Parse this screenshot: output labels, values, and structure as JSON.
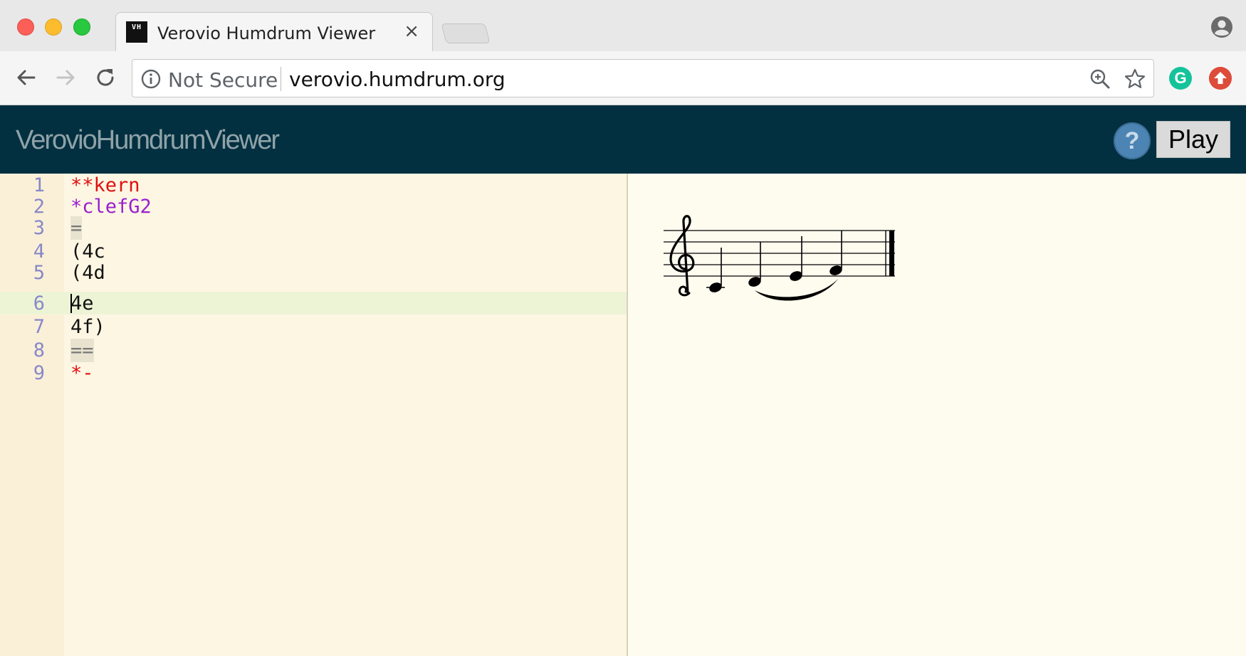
{
  "browser": {
    "tab_title": "Verovio Humdrum Viewer",
    "tab_close": "×",
    "favicon_text": "VH",
    "security_label": "Not Secure",
    "url": "verovio.humdrum.org"
  },
  "app": {
    "title": "VerovioHumdrumViewer",
    "help_label": "?",
    "play_label": "Play"
  },
  "editor": {
    "active_line": 6,
    "lines": [
      {
        "num": "1",
        "text": "**kern"
      },
      {
        "num": "2",
        "text": "*clefG2"
      },
      {
        "num": "3",
        "text": "="
      },
      {
        "num": "4",
        "text": "(4c"
      },
      {
        "num": "5",
        "text": "(4d"
      },
      {
        "num": "6",
        "text": "4e"
      },
      {
        "num": "7",
        "text": "4f)"
      },
      {
        "num": "8",
        "text": "=="
      },
      {
        "num": "9",
        "text": "*-"
      }
    ]
  },
  "score": {
    "clef": "G2",
    "notes": [
      "c",
      "d",
      "e",
      "f"
    ],
    "slur_from_note": 2,
    "slur_to_note": 4,
    "final_barline": true
  },
  "colors": {
    "header_bg": "#023040",
    "editor_bg": "#fdf6e3",
    "keyword_red": "#e01010",
    "clef_purple": "#9a1fcf",
    "line_number": "#8888c8",
    "help_blue": "#4c84b4"
  }
}
